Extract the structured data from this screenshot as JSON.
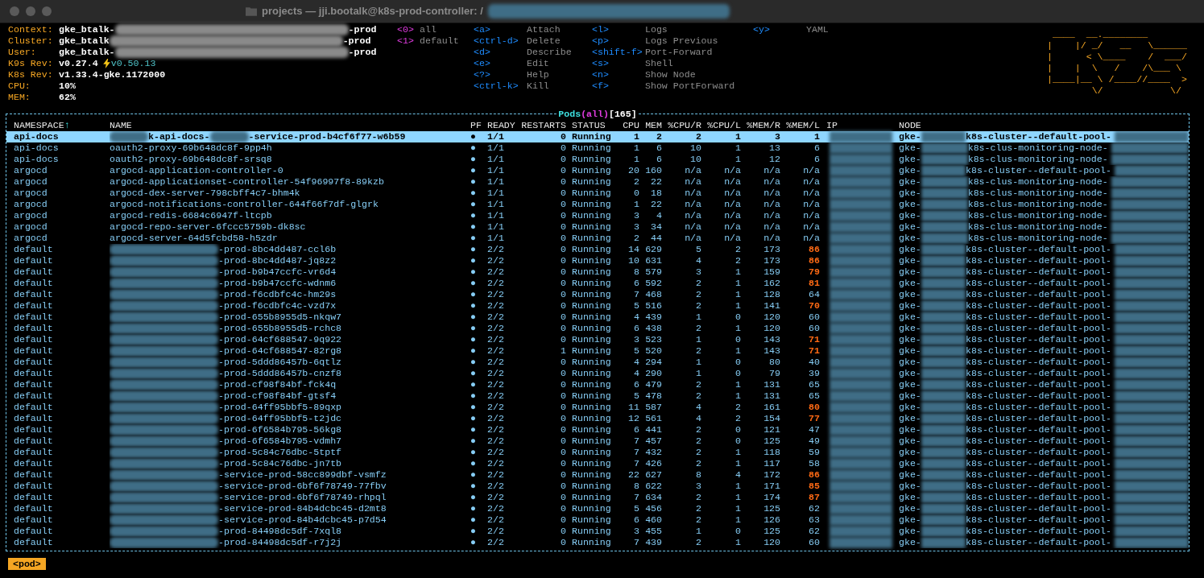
{
  "window": {
    "title": "projects — jji.bootalk@k8s-prod-controller: /"
  },
  "info": [
    {
      "label": "Context:",
      "value": [
        "gke_btalk-",
        "-prod"
      ]
    },
    {
      "label": "Cluster:",
      "value": [
        "gke_btalk",
        "-prod"
      ]
    },
    {
      "label": "User:",
      "value": [
        "gke_btalk-",
        "-prod"
      ]
    },
    {
      "label": "K9s Rev:",
      "value": [
        "v0.27.4"
      ],
      "upgrade": "v0.50.13"
    },
    {
      "label": "K8s Rev:",
      "value": [
        "v1.33.4-gke.1172000"
      ]
    },
    {
      "label": "CPU:",
      "value": [
        "10%"
      ]
    },
    {
      "label": "MEM:",
      "value": [
        "62%"
      ]
    }
  ],
  "namespaces": [
    {
      "key": "<0>",
      "label": "all"
    },
    {
      "key": "<1>",
      "label": "default"
    }
  ],
  "shortcuts": [
    [
      {
        "key": "<a>",
        "label": "Attach"
      },
      {
        "key": "<ctrl-d>",
        "label": "Delete"
      },
      {
        "key": "<d>",
        "label": "Describe"
      },
      {
        "key": "<e>",
        "label": "Edit"
      },
      {
        "key": "<?>",
        "label": "Help"
      },
      {
        "key": "<ctrl-k>",
        "label": "Kill"
      }
    ],
    [
      {
        "key": "<l>",
        "label": "Logs"
      },
      {
        "key": "<p>",
        "label": "Logs Previous"
      },
      {
        "key": "<shift-f>",
        "label": "Port-Forward"
      },
      {
        "key": "<s>",
        "label": "Shell"
      },
      {
        "key": "<n>",
        "label": "Show Node"
      },
      {
        "key": "<f>",
        "label": "Show PortForward"
      }
    ],
    [
      {
        "key": "<y>",
        "label": "YAML"
      }
    ]
  ],
  "logo": [
    " ____  __.________       ",
    "|    |/ _/   __   \\______",
    "|      < \\____    /  ___/",
    "|    |  \\   /    /\\___ \\ ",
    "|____|__ \\ /____//____  >",
    "        \\/            \\/ "
  ],
  "table": {
    "title": {
      "resource": "Pods",
      "scope": "(all)",
      "count": "[165]"
    },
    "columns": [
      {
        "label": "NAMESPACE",
        "sort": "↑"
      },
      {
        "label": "NAME"
      },
      {
        "label": "PF"
      },
      {
        "label": "READY"
      },
      {
        "label": "RESTARTS"
      },
      {
        "label": "STATUS"
      },
      {
        "label": "CPU"
      },
      {
        "label": "MEM"
      },
      {
        "label": "%CPU/R"
      },
      {
        "label": "%CPU/L"
      },
      {
        "label": "%MEM/R"
      },
      {
        "label": "%MEM/L"
      },
      {
        "label": "IP"
      },
      {
        "label": "NODE"
      }
    ],
    "rows": [
      {
        "ns": "api-docs",
        "name": [
          "k-api-docs-",
          "-service-prod-b4cf6f77-w6b59"
        ],
        "name_masked": true,
        "pf": "●",
        "ready": "1/1",
        "restarts": "0",
        "status": "Running",
        "cpu": "1",
        "mem": "2",
        "cpu_r": "2",
        "cpu_l": "1",
        "mem_r": "3",
        "mem_l": "1",
        "mem_l_warn": false,
        "node": [
          "gke-",
          "k8s-cluster--default-pool-"
        ],
        "selected": true
      },
      {
        "ns": "api-docs",
        "name": [
          "oauth2-proxy-69b648dc8f-9pp4h"
        ],
        "name_masked": false,
        "pf": "●",
        "ready": "1/1",
        "restarts": "0",
        "status": "Running",
        "cpu": "1",
        "mem": "6",
        "cpu_r": "10",
        "cpu_l": "1",
        "mem_r": "13",
        "mem_l": "6",
        "mem_l_warn": false,
        "node": [
          "gke-",
          "k8s-clus-monitoring-node-"
        ],
        "selected": false
      },
      {
        "ns": "api-docs",
        "name": [
          "oauth2-proxy-69b648dc8f-srsq8"
        ],
        "name_masked": false,
        "pf": "●",
        "ready": "1/1",
        "restarts": "0",
        "status": "Running",
        "cpu": "1",
        "mem": "6",
        "cpu_r": "10",
        "cpu_l": "1",
        "mem_r": "12",
        "mem_l": "6",
        "mem_l_warn": false,
        "node": [
          "gke-",
          "k8s-clus-monitoring-node-"
        ],
        "selected": false
      },
      {
        "ns": "argocd",
        "name": [
          "argocd-application-controller-0"
        ],
        "name_masked": false,
        "pf": "●",
        "ready": "1/1",
        "restarts": "0",
        "status": "Running",
        "cpu": "20",
        "mem": "160",
        "cpu_r": "n/a",
        "cpu_l": "n/a",
        "mem_r": "n/a",
        "mem_l": "n/a",
        "mem_l_warn": false,
        "node": [
          "gke-",
          "k8s-cluster--default-pool-"
        ],
        "selected": false
      },
      {
        "ns": "argocd",
        "name": [
          "argocd-applicationset-controller-54f96997f8-89kzb"
        ],
        "name_masked": false,
        "pf": "●",
        "ready": "1/1",
        "restarts": "0",
        "status": "Running",
        "cpu": "2",
        "mem": "22",
        "cpu_r": "n/a",
        "cpu_l": "n/a",
        "mem_r": "n/a",
        "mem_l": "n/a",
        "mem_l_warn": false,
        "node": [
          "gke-",
          "k8s-clus-monitoring-node-"
        ],
        "selected": false
      },
      {
        "ns": "argocd",
        "name": [
          "argocd-dex-server-798cbff4c7-bhm4k"
        ],
        "name_masked": false,
        "pf": "●",
        "ready": "1/1",
        "restarts": "0",
        "status": "Running",
        "cpu": "0",
        "mem": "18",
        "cpu_r": "n/a",
        "cpu_l": "n/a",
        "mem_r": "n/a",
        "mem_l": "n/a",
        "mem_l_warn": false,
        "node": [
          "gke-",
          "k8s-clus-monitoring-node-"
        ],
        "selected": false
      },
      {
        "ns": "argocd",
        "name": [
          "argocd-notifications-controller-644f66f7df-glgrk"
        ],
        "name_masked": false,
        "pf": "●",
        "ready": "1/1",
        "restarts": "0",
        "status": "Running",
        "cpu": "1",
        "mem": "22",
        "cpu_r": "n/a",
        "cpu_l": "n/a",
        "mem_r": "n/a",
        "mem_l": "n/a",
        "mem_l_warn": false,
        "node": [
          "gke-",
          "k8s-clus-monitoring-node-"
        ],
        "selected": false
      },
      {
        "ns": "argocd",
        "name": [
          "argocd-redis-6684c6947f-ltcpb"
        ],
        "name_masked": false,
        "pf": "●",
        "ready": "1/1",
        "restarts": "0",
        "status": "Running",
        "cpu": "3",
        "mem": "4",
        "cpu_r": "n/a",
        "cpu_l": "n/a",
        "mem_r": "n/a",
        "mem_l": "n/a",
        "mem_l_warn": false,
        "node": [
          "gke-",
          "k8s-clus-monitoring-node-"
        ],
        "selected": false
      },
      {
        "ns": "argocd",
        "name": [
          "argocd-repo-server-6fccc5759b-dk8sc"
        ],
        "name_masked": false,
        "pf": "●",
        "ready": "1/1",
        "restarts": "0",
        "status": "Running",
        "cpu": "3",
        "mem": "34",
        "cpu_r": "n/a",
        "cpu_l": "n/a",
        "mem_r": "n/a",
        "mem_l": "n/a",
        "mem_l_warn": false,
        "node": [
          "gke-",
          "k8s-clus-monitoring-node-"
        ],
        "selected": false
      },
      {
        "ns": "argocd",
        "name": [
          "argocd-server-64d5fcbd58-h5zdr"
        ],
        "name_masked": false,
        "pf": "●",
        "ready": "1/1",
        "restarts": "0",
        "status": "Running",
        "cpu": "2",
        "mem": "44",
        "cpu_r": "n/a",
        "cpu_l": "n/a",
        "mem_r": "n/a",
        "mem_l": "n/a",
        "mem_l_warn": false,
        "node": [
          "gke-",
          "k8s-clus-monitoring-node-"
        ],
        "selected": false
      },
      {
        "ns": "default",
        "name": [
          "-prod-8bc4dd487-ccl6b"
        ],
        "name_masked": true,
        "pf": "●",
        "ready": "2/2",
        "restarts": "0",
        "status": "Running",
        "cpu": "14",
        "mem": "629",
        "cpu_r": "5",
        "cpu_l": "2",
        "mem_r": "173",
        "mem_l": "86",
        "mem_l_warn": true,
        "node": [
          "gke-",
          "k8s-cluster--default-pool-"
        ],
        "selected": false
      },
      {
        "ns": "default",
        "name": [
          "-prod-8bc4dd487-jq8z2"
        ],
        "name_masked": true,
        "pf": "●",
        "ready": "2/2",
        "restarts": "0",
        "status": "Running",
        "cpu": "10",
        "mem": "631",
        "cpu_r": "4",
        "cpu_l": "2",
        "mem_r": "173",
        "mem_l": "86",
        "mem_l_warn": true,
        "node": [
          "gke-",
          "k8s-cluster--default-pool-"
        ],
        "selected": false
      },
      {
        "ns": "default",
        "name": [
          "-prod-b9b47ccfc-vr6d4"
        ],
        "name_masked": true,
        "pf": "●",
        "ready": "2/2",
        "restarts": "0",
        "status": "Running",
        "cpu": "8",
        "mem": "579",
        "cpu_r": "3",
        "cpu_l": "1",
        "mem_r": "159",
        "mem_l": "79",
        "mem_l_warn": true,
        "node": [
          "gke-",
          "k8s-cluster--default-pool-"
        ],
        "selected": false
      },
      {
        "ns": "default",
        "name": [
          "-prod-b9b47ccfc-wdnm6"
        ],
        "name_masked": true,
        "pf": "●",
        "ready": "2/2",
        "restarts": "0",
        "status": "Running",
        "cpu": "6",
        "mem": "592",
        "cpu_r": "2",
        "cpu_l": "1",
        "mem_r": "162",
        "mem_l": "81",
        "mem_l_warn": true,
        "node": [
          "gke-",
          "k8s-cluster--default-pool-"
        ],
        "selected": false
      },
      {
        "ns": "default",
        "name": [
          "-prod-f6cdbfc4c-hm29s"
        ],
        "name_masked": true,
        "pf": "●",
        "ready": "2/2",
        "restarts": "0",
        "status": "Running",
        "cpu": "7",
        "mem": "468",
        "cpu_r": "2",
        "cpu_l": "1",
        "mem_r": "128",
        "mem_l": "64",
        "mem_l_warn": false,
        "node": [
          "gke-",
          "k8s-cluster--default-pool-"
        ],
        "selected": false
      },
      {
        "ns": "default",
        "name": [
          "-prod-f6cdbfc4c-vzd7x"
        ],
        "name_masked": true,
        "pf": "●",
        "ready": "2/2",
        "restarts": "0",
        "status": "Running",
        "cpu": "5",
        "mem": "516",
        "cpu_r": "2",
        "cpu_l": "1",
        "mem_r": "141",
        "mem_l": "70",
        "mem_l_warn": true,
        "node": [
          "gke-",
          "k8s-cluster--default-pool-"
        ],
        "selected": false
      },
      {
        "ns": "default",
        "name": [
          "-prod-655b8955d5-nkqw7"
        ],
        "name_masked": true,
        "pf": "●",
        "ready": "2/2",
        "restarts": "0",
        "status": "Running",
        "cpu": "4",
        "mem": "439",
        "cpu_r": "1",
        "cpu_l": "0",
        "mem_r": "120",
        "mem_l": "60",
        "mem_l_warn": false,
        "node": [
          "gke-",
          "k8s-cluster--default-pool-"
        ],
        "selected": false
      },
      {
        "ns": "default",
        "name": [
          "-prod-655b8955d5-rchc8"
        ],
        "name_masked": true,
        "pf": "●",
        "ready": "2/2",
        "restarts": "0",
        "status": "Running",
        "cpu": "6",
        "mem": "438",
        "cpu_r": "2",
        "cpu_l": "1",
        "mem_r": "120",
        "mem_l": "60",
        "mem_l_warn": false,
        "node": [
          "gke-",
          "k8s-cluster--default-pool-"
        ],
        "selected": false
      },
      {
        "ns": "default",
        "name": [
          "-prod-64cf688547-9q922"
        ],
        "name_masked": true,
        "pf": "●",
        "ready": "2/2",
        "restarts": "0",
        "status": "Running",
        "cpu": "3",
        "mem": "523",
        "cpu_r": "1",
        "cpu_l": "0",
        "mem_r": "143",
        "mem_l": "71",
        "mem_l_warn": true,
        "node": [
          "gke-",
          "k8s-cluster--default-pool-"
        ],
        "selected": false
      },
      {
        "ns": "default",
        "name": [
          "-prod-64cf688547-82rg8"
        ],
        "name_masked": true,
        "pf": "●",
        "ready": "2/2",
        "restarts": "1",
        "status": "Running",
        "cpu": "5",
        "mem": "520",
        "cpu_r": "2",
        "cpu_l": "1",
        "mem_r": "143",
        "mem_l": "71",
        "mem_l_warn": true,
        "node": [
          "gke-",
          "k8s-cluster--default-pool-"
        ],
        "selected": false
      },
      {
        "ns": "default",
        "name": [
          "-prod-5ddd86457b-6qtlz"
        ],
        "name_masked": true,
        "pf": "●",
        "ready": "2/2",
        "restarts": "0",
        "status": "Running",
        "cpu": "4",
        "mem": "294",
        "cpu_r": "1",
        "cpu_l": "0",
        "mem_r": "80",
        "mem_l": "40",
        "mem_l_warn": false,
        "node": [
          "gke-",
          "k8s-cluster--default-pool-"
        ],
        "selected": false
      },
      {
        "ns": "default",
        "name": [
          "-prod-5ddd86457b-cnzf8"
        ],
        "name_masked": true,
        "pf": "●",
        "ready": "2/2",
        "restarts": "0",
        "status": "Running",
        "cpu": "4",
        "mem": "290",
        "cpu_r": "1",
        "cpu_l": "0",
        "mem_r": "79",
        "mem_l": "39",
        "mem_l_warn": false,
        "node": [
          "gke-",
          "k8s-cluster--default-pool-"
        ],
        "selected": false
      },
      {
        "ns": "default",
        "name": [
          "-prod-cf98f84bf-fck4q"
        ],
        "name_masked": true,
        "pf": "●",
        "ready": "2/2",
        "restarts": "0",
        "status": "Running",
        "cpu": "6",
        "mem": "479",
        "cpu_r": "2",
        "cpu_l": "1",
        "mem_r": "131",
        "mem_l": "65",
        "mem_l_warn": false,
        "node": [
          "gke-",
          "k8s-cluster--default-pool-"
        ],
        "selected": false
      },
      {
        "ns": "default",
        "name": [
          "-prod-cf98f84bf-gtsf4"
        ],
        "name_masked": true,
        "pf": "●",
        "ready": "2/2",
        "restarts": "0",
        "status": "Running",
        "cpu": "5",
        "mem": "478",
        "cpu_r": "2",
        "cpu_l": "1",
        "mem_r": "131",
        "mem_l": "65",
        "mem_l_warn": false,
        "node": [
          "gke-",
          "k8s-cluster--default-pool-"
        ],
        "selected": false
      },
      {
        "ns": "default",
        "name": [
          "-prod-64ff95bbf5-89qxp"
        ],
        "name_masked": true,
        "pf": "●",
        "ready": "2/2",
        "restarts": "0",
        "status": "Running",
        "cpu": "11",
        "mem": "587",
        "cpu_r": "4",
        "cpu_l": "2",
        "mem_r": "161",
        "mem_l": "80",
        "mem_l_warn": true,
        "node": [
          "gke-",
          "k8s-cluster--default-pool-"
        ],
        "selected": false
      },
      {
        "ns": "default",
        "name": [
          "-prod-64ff95bbf5-t2jdc"
        ],
        "name_masked": true,
        "pf": "●",
        "ready": "2/2",
        "restarts": "0",
        "status": "Running",
        "cpu": "12",
        "mem": "561",
        "cpu_r": "4",
        "cpu_l": "2",
        "mem_r": "154",
        "mem_l": "77",
        "mem_l_warn": true,
        "node": [
          "gke-",
          "k8s-cluster--default-pool-"
        ],
        "selected": false
      },
      {
        "ns": "default",
        "name": [
          "-prod-6f6584b795-56kg8"
        ],
        "name_masked": true,
        "pf": "●",
        "ready": "2/2",
        "restarts": "0",
        "status": "Running",
        "cpu": "6",
        "mem": "441",
        "cpu_r": "2",
        "cpu_l": "0",
        "mem_r": "121",
        "mem_l": "47",
        "mem_l_warn": false,
        "node": [
          "gke-",
          "k8s-cluster--default-pool-"
        ],
        "selected": false
      },
      {
        "ns": "default",
        "name": [
          "-prod-6f6584b795-vdmh7"
        ],
        "name_masked": true,
        "pf": "●",
        "ready": "2/2",
        "restarts": "0",
        "status": "Running",
        "cpu": "7",
        "mem": "457",
        "cpu_r": "2",
        "cpu_l": "0",
        "mem_r": "125",
        "mem_l": "49",
        "mem_l_warn": false,
        "node": [
          "gke-",
          "k8s-cluster--default-pool-"
        ],
        "selected": false
      },
      {
        "ns": "default",
        "name": [
          "-prod-5c84c76dbc-5tptf"
        ],
        "name_masked": true,
        "pf": "●",
        "ready": "2/2",
        "restarts": "0",
        "status": "Running",
        "cpu": "7",
        "mem": "432",
        "cpu_r": "2",
        "cpu_l": "1",
        "mem_r": "118",
        "mem_l": "59",
        "mem_l_warn": false,
        "node": [
          "gke-",
          "k8s-cluster--default-pool-"
        ],
        "selected": false
      },
      {
        "ns": "default",
        "name": [
          "-prod-5c84c76dbc-jn7tb"
        ],
        "name_masked": true,
        "pf": "●",
        "ready": "2/2",
        "restarts": "0",
        "status": "Running",
        "cpu": "7",
        "mem": "426",
        "cpu_r": "2",
        "cpu_l": "1",
        "mem_r": "117",
        "mem_l": "58",
        "mem_l_warn": false,
        "node": [
          "gke-",
          "k8s-cluster--default-pool-"
        ],
        "selected": false
      },
      {
        "ns": "default",
        "name": [
          "-service-prod-58cc899dbf-vsmfz"
        ],
        "name_masked": true,
        "pf": "●",
        "ready": "2/2",
        "restarts": "0",
        "status": "Running",
        "cpu": "22",
        "mem": "627",
        "cpu_r": "8",
        "cpu_l": "4",
        "mem_r": "172",
        "mem_l": "86",
        "mem_l_warn": true,
        "node": [
          "gke-",
          "k8s-cluster--default-pool-"
        ],
        "selected": false
      },
      {
        "ns": "default",
        "name": [
          "-service-prod-6bf6f78749-77fbv"
        ],
        "name_masked": true,
        "pf": "●",
        "ready": "2/2",
        "restarts": "0",
        "status": "Running",
        "cpu": "8",
        "mem": "622",
        "cpu_r": "3",
        "cpu_l": "1",
        "mem_r": "171",
        "mem_l": "85",
        "mem_l_warn": true,
        "node": [
          "gke-",
          "k8s-cluster--default-pool-"
        ],
        "selected": false
      },
      {
        "ns": "default",
        "name": [
          "-service-prod-6bf6f78749-rhpql"
        ],
        "name_masked": true,
        "pf": "●",
        "ready": "2/2",
        "restarts": "0",
        "status": "Running",
        "cpu": "7",
        "mem": "634",
        "cpu_r": "2",
        "cpu_l": "1",
        "mem_r": "174",
        "mem_l": "87",
        "mem_l_warn": true,
        "node": [
          "gke-",
          "k8s-cluster--default-pool-"
        ],
        "selected": false
      },
      {
        "ns": "default",
        "name": [
          "-service-prod-84b4dcbc45-d2mt8"
        ],
        "name_masked": true,
        "pf": "●",
        "ready": "2/2",
        "restarts": "0",
        "status": "Running",
        "cpu": "5",
        "mem": "456",
        "cpu_r": "2",
        "cpu_l": "1",
        "mem_r": "125",
        "mem_l": "62",
        "mem_l_warn": false,
        "node": [
          "gke-",
          "k8s-cluster--default-pool-"
        ],
        "selected": false
      },
      {
        "ns": "default",
        "name": [
          "-service-prod-84b4dcbc45-p7d54"
        ],
        "name_masked": true,
        "pf": "●",
        "ready": "2/2",
        "restarts": "0",
        "status": "Running",
        "cpu": "6",
        "mem": "460",
        "cpu_r": "2",
        "cpu_l": "1",
        "mem_r": "126",
        "mem_l": "63",
        "mem_l_warn": false,
        "node": [
          "gke-",
          "k8s-cluster--default-pool-"
        ],
        "selected": false
      },
      {
        "ns": "default",
        "name": [
          "-prod-84498dc5df-7xql8"
        ],
        "name_masked": true,
        "pf": "●",
        "ready": "2/2",
        "restarts": "0",
        "status": "Running",
        "cpu": "3",
        "mem": "455",
        "cpu_r": "1",
        "cpu_l": "0",
        "mem_r": "125",
        "mem_l": "62",
        "mem_l_warn": false,
        "node": [
          "gke-",
          "k8s-cluster--default-pool-"
        ],
        "selected": false
      },
      {
        "ns": "default",
        "name": [
          "-prod-84498dc5df-r7j2j"
        ],
        "name_masked": true,
        "pf": "●",
        "ready": "2/2",
        "restarts": "0",
        "status": "Running",
        "cpu": "7",
        "mem": "439",
        "cpu_r": "2",
        "cpu_l": "1",
        "mem_r": "120",
        "mem_l": "60",
        "mem_l_warn": false,
        "node": [
          "gke-",
          "k8s-cluster--default-pool-"
        ],
        "selected": false
      }
    ]
  },
  "breadcrumb": "<pod>"
}
